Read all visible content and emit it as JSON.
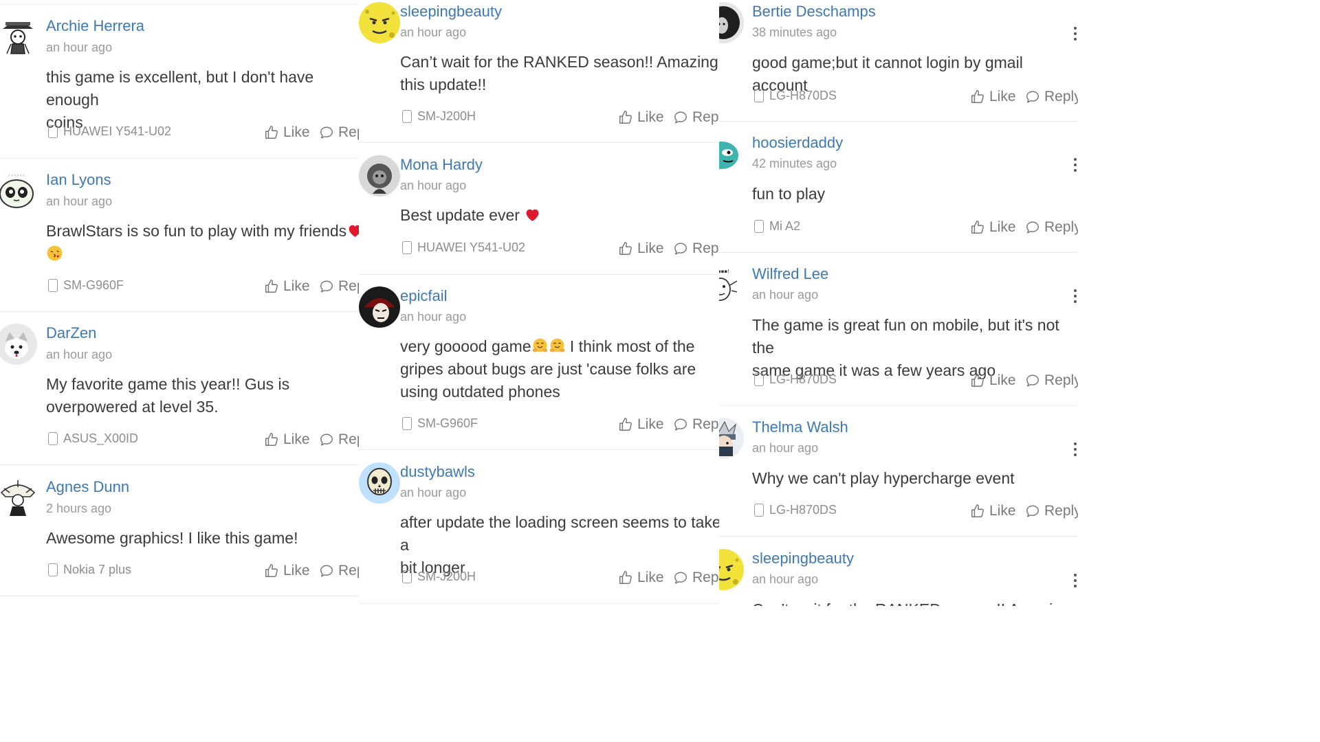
{
  "actions": {
    "like": "Like",
    "reply": "Reply"
  },
  "columns": [
    {
      "comments": [
        {
          "name": "Archie Herrera",
          "time": "an hour ago",
          "text": "this game is excellent, but I don't have enough\ncoins",
          "device": "HUAWEI Y541-U02"
        },
        {
          "name": "Ian Lyons",
          "time": "an hour ago",
          "text": "BrawlStars is so fun to play with my friends",
          "device": "SM-G960F"
        },
        {
          "name": "DarZen",
          "time": "an hour ago",
          "text": "My favorite game this year!! Gus is\noverpowered at level 35.",
          "device": "ASUS_X00ID"
        },
        {
          "name": "Agnes Dunn",
          "time": "2 hours ago",
          "text": "Awesome graphics! I like this game!",
          "device": "Nokia 7 plus"
        }
      ]
    },
    {
      "comments": [
        {
          "name": "sleepingbeauty",
          "time": "an hour ago",
          "text": "Can’t wait for the RANKED season!! Amazing\nthis update!!",
          "device": "SM-J200H"
        },
        {
          "name": "Mona Hardy",
          "time": "an hour ago",
          "text": "Best update ever",
          "device": "HUAWEI Y541-U02"
        },
        {
          "name": "epicfail",
          "time": "an hour ago",
          "text_a": "very gooood game",
          "text_b": " I think most of the\ngripes about bugs are just 'cause folks are\nusing outdated phones",
          "device": "SM-G960F"
        },
        {
          "name": "dustybawls",
          "time": "an hour ago",
          "text": "after update the loading screen seems to take a\nbit longer",
          "device": "SM-J200H"
        }
      ]
    },
    {
      "comments": [
        {
          "name": "Bertie Deschamps",
          "time": "38 minutes ago",
          "text": "good game;but it cannot login by gmail account",
          "device": "LG-H870DS"
        },
        {
          "name": "hoosierdaddy",
          "time": "42 minutes ago",
          "text": "fun to play",
          "device": "Mi A2"
        },
        {
          "name": "Wilfred Lee",
          "time": "an hour ago",
          "text": "The game is great fun on mobile, but it's not the\nsame game it was a few years ago",
          "device": "LG-H870DS"
        },
        {
          "name": "Thelma Walsh",
          "time": "an hour ago",
          "text": "Why we can't play hypercharge event",
          "device": "LG-H870DS"
        },
        {
          "name": "sleepingbeauty",
          "time": "an hour ago",
          "text": "Can’t wait for the RANKED season!! Amazing",
          "device": ""
        }
      ]
    }
  ],
  "colors": {
    "name": "#3d79b5",
    "time": "#9a9a9a",
    "text": "#3b3b3b",
    "divider": "#ececec",
    "heart": "#e0182d"
  },
  "icons": [
    "thumbs-up-icon",
    "speech-bubble-icon",
    "phone-icon",
    "more-vert-icon",
    "heart-emoji",
    "kiss-emoji",
    "hug-emoji"
  ]
}
